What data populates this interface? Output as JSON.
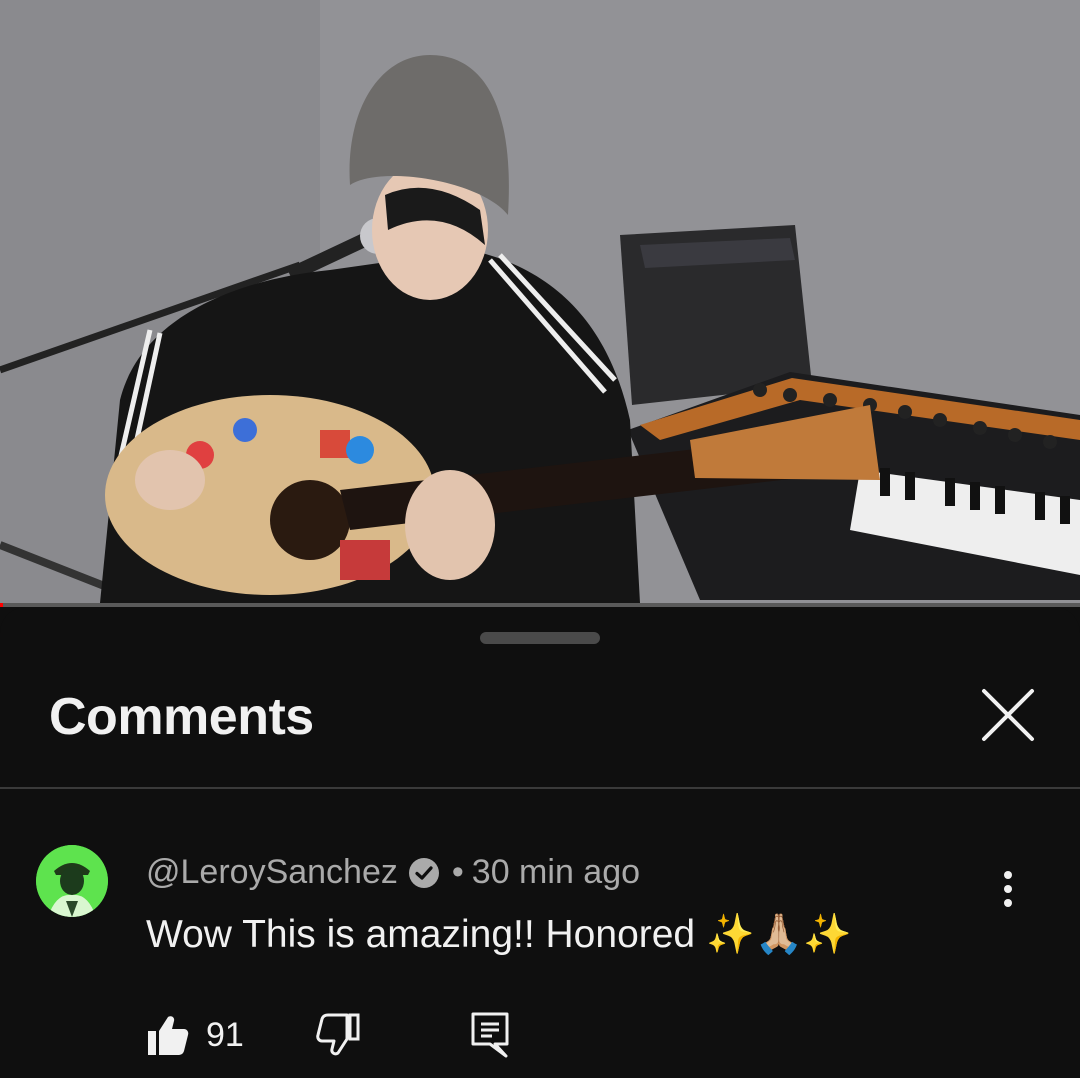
{
  "video": {
    "progress": 0.003
  },
  "sheet": {
    "title": "Comments"
  },
  "comment": {
    "author": "@LeroySanchez",
    "separator": "•",
    "timestamp": "30 min ago",
    "text": "Wow This is amazing!! Honored ✨🙏🏼✨",
    "like_count": "91"
  },
  "icons": {
    "close": "close-icon",
    "verified": "verified-check-icon",
    "more": "more-vertical-icon",
    "like": "thumbs-up-icon",
    "dislike": "thumbs-down-icon",
    "reply": "reply-icon"
  },
  "colors": {
    "background": "#0f0f0f",
    "text": "#f1f1f1",
    "secondary_text": "#aaaaaa",
    "progress": "#ff0000",
    "avatar": "#55e04a"
  }
}
